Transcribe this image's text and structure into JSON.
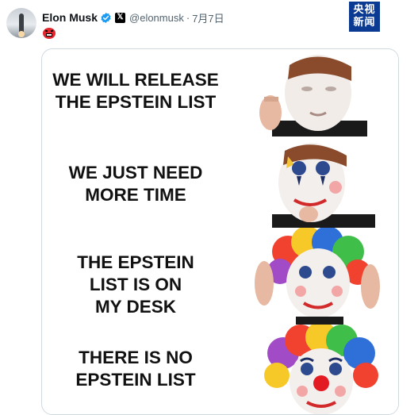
{
  "author": {
    "display_name": "Elon Musk",
    "handle": "@elonmusk",
    "separator": "·",
    "date": "7月7日",
    "affiliation_badge": "𝕏"
  },
  "icons": {
    "avatar": "rocket-avatar",
    "verified": "verified-badge-icon",
    "emoji": "cursing-face-emoji"
  },
  "watermark": {
    "line1": "央视",
    "line2": "新闻"
  },
  "meme": {
    "panels": [
      {
        "lines": [
          "WE WILL RELEASE",
          "THE EPSTEIN LIST"
        ]
      },
      {
        "lines": [
          "WE JUST NEED",
          "MORE TIME"
        ]
      },
      {
        "lines": [
          "THE EPSTEIN",
          "LIST IS ON",
          "MY DESK"
        ]
      },
      {
        "lines": [
          "THERE IS NO",
          "EPSTEIN LIST"
        ]
      }
    ]
  },
  "colors": {
    "verified_blue": "#1d9bf0",
    "text_primary": "#0f1419",
    "text_secondary": "#536471",
    "watermark_bg": "#0b3a93",
    "emoji_red": "#e3262d",
    "card_border": "#cfd9de"
  }
}
